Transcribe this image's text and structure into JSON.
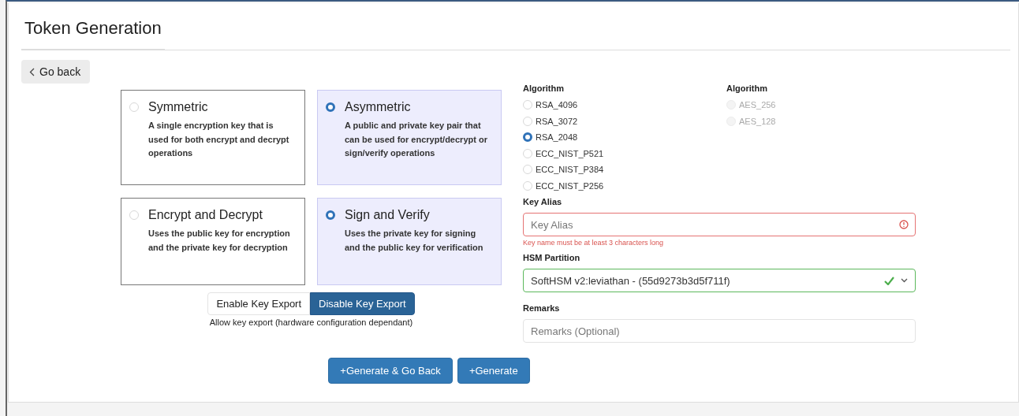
{
  "title": "Token Generation",
  "back_button": "Go back",
  "key_types": [
    {
      "title": "Symmetric",
      "description": "A single encryption key that is used for both encrypt and decrypt operations",
      "selected": false
    },
    {
      "title": "Asymmetric",
      "description": "A public and private key pair that can be used for encrypt/decrypt or sign/verify operations",
      "selected": true
    },
    {
      "title": "Encrypt and Decrypt",
      "description": "Uses the public key for encryption and the private key for decryption",
      "selected": false
    },
    {
      "title": "Sign and Verify",
      "description": "Uses the private key for signing and the public key for verification",
      "selected": true
    }
  ],
  "export_toggle": [
    {
      "label": "Enable Key Export",
      "selected": false
    },
    {
      "label": "Disable Key Export",
      "selected": true
    }
  ],
  "export_hint": "Allow key export (hardware configuration dependant)",
  "algorithm_groups": [
    {
      "label": "Algorithm",
      "options": [
        {
          "label": "RSA_4096",
          "selected": false,
          "disabled": false
        },
        {
          "label": "RSA_3072",
          "selected": false,
          "disabled": false
        },
        {
          "label": "RSA_2048",
          "selected": true,
          "disabled": false
        },
        {
          "label": "ECC_NIST_P521",
          "selected": false,
          "disabled": false
        },
        {
          "label": "ECC_NIST_P384",
          "selected": false,
          "disabled": false
        },
        {
          "label": "ECC_NIST_P256",
          "selected": false,
          "disabled": false
        }
      ]
    },
    {
      "label": "Algorithm",
      "options": [
        {
          "label": "AES_256",
          "selected": false,
          "disabled": true
        },
        {
          "label": "AES_128",
          "selected": false,
          "disabled": true
        }
      ]
    }
  ],
  "key_alias": {
    "label": "Key Alias",
    "placeholder": "Key Alias",
    "invalid": true,
    "error": "Key name must be at least 3 characters long"
  },
  "hsm_partition": {
    "label": "HSM Partition",
    "value": "SoftHSM v2:leviathan - (55d9273b3d5f711f)",
    "valid": true
  },
  "remarks": {
    "label": "Remarks",
    "placeholder": "Remarks (Optional)"
  },
  "actions": [
    "+Generate & Go Back",
    "+Generate"
  ]
}
